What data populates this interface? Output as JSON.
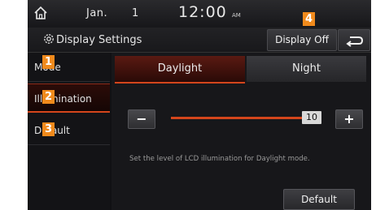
{
  "statusbar": {
    "home_icon": "home-icon",
    "date_month": "Jan.",
    "date_day": "1",
    "time": "12:00",
    "ampm": "AM"
  },
  "titlebar": {
    "settings_icon": "gear-icon",
    "title": "Display Settings",
    "display_off_label": "Display Off",
    "back_icon": "back-arrow-icon"
  },
  "sidebar": {
    "items": [
      {
        "label": "Mode",
        "active": false
      },
      {
        "label": "Illumination",
        "active": true
      },
      {
        "label": "Default",
        "active": false
      }
    ]
  },
  "tabs": [
    {
      "label": "Daylight",
      "selected": true
    },
    {
      "label": "Night",
      "selected": false
    }
  ],
  "illumination": {
    "minus_label": "−",
    "plus_label": "+",
    "value": "10",
    "level_fraction": 1.0,
    "description": "Set the level of LCD illumination for Daylight mode.",
    "default_label": "Default"
  },
  "markers": [
    "1",
    "2",
    "3",
    "4"
  ],
  "colors": {
    "accent": "#d4461c",
    "marker": "#f08a1c",
    "background": "#111114"
  }
}
